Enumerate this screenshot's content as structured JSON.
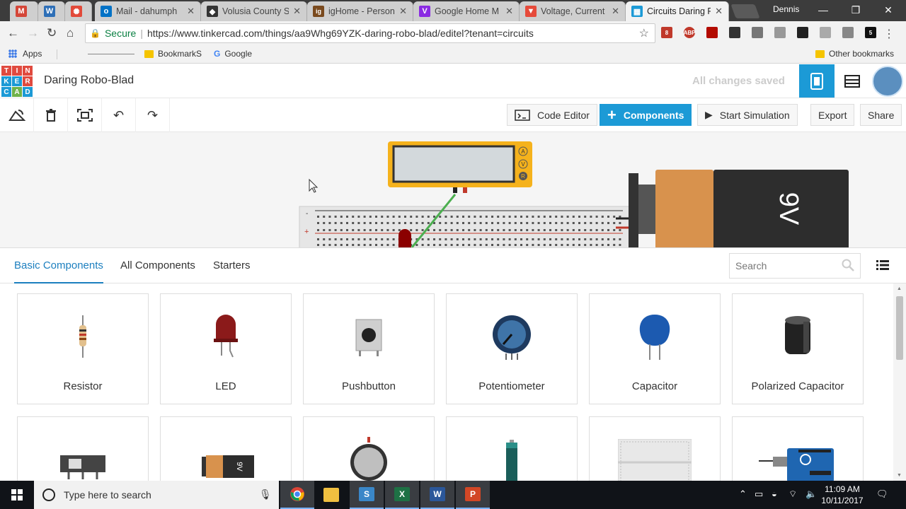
{
  "browser": {
    "tabs": [
      {
        "title": "",
        "icon": "gmail-icon",
        "color": "#d44638",
        "glyph": "M"
      },
      {
        "title": "",
        "icon": "wordpress-icon",
        "color": "#2e6fb7",
        "glyph": "W"
      },
      {
        "title": "",
        "icon": "aperture-icon",
        "color": "#e24a3a",
        "glyph": "✺"
      },
      {
        "title": "Mail - dahumph",
        "icon": "outlook-icon",
        "color": "#0072c6",
        "glyph": "o"
      },
      {
        "title": "Volusia County S",
        "icon": "volusia-icon",
        "color": "#333333",
        "glyph": "◆"
      },
      {
        "title": "igHome - Person",
        "icon": "ighome-icon",
        "color": "#7a4a1e",
        "glyph": "ig"
      },
      {
        "title": "Google Home M",
        "icon": "vivaldi-icon",
        "color": "#8a2be2",
        "glyph": "V"
      },
      {
        "title": "Voltage, Current",
        "icon": "bookmark-red-icon",
        "color": "#e64a3a",
        "glyph": "▼"
      },
      {
        "title": "Circuits Daring R",
        "icon": "tinkercad-icon",
        "color": "#1c9ad6",
        "glyph": "▦"
      }
    ],
    "user": "Dennis",
    "url_secure": "Secure",
    "url": "https://www.tinkercad.com/things/aa9Whg69YZK-daring-robo-blad/editel?tenant=circuits",
    "bookmarks": {
      "apps": "Apps",
      "folder1": "BookmarkS",
      "google": "Google",
      "other": "Other bookmarks"
    },
    "extensions": [
      {
        "icon": "calendar-icon",
        "color": "#c0392b",
        "badge": "8"
      },
      {
        "icon": "adblock-icon",
        "color": "#c0392b",
        "badge": "ABP"
      },
      {
        "icon": "pdf-icon",
        "color": "#b30b00",
        "badge": ""
      },
      {
        "icon": "film-icon",
        "color": "#333333",
        "badge": ""
      },
      {
        "icon": "shield-icon",
        "color": "#777777",
        "badge": ""
      },
      {
        "icon": "leaf-icon",
        "color": "#999999",
        "badge": ""
      },
      {
        "icon": "cloud-icon",
        "color": "#222222",
        "badge": ""
      },
      {
        "icon": "printer-icon",
        "color": "#aaaaaa",
        "badge": ""
      },
      {
        "icon": "translate-icon",
        "color": "#888888",
        "badge": ""
      },
      {
        "icon": "amazon-icon",
        "color": "#111111",
        "badge": "5"
      }
    ]
  },
  "app": {
    "logo_letters": [
      "T",
      "I",
      "N",
      "K",
      "E",
      "R",
      "C",
      "A",
      "D"
    ],
    "logo_colors": [
      "#e04a3f",
      "#e04a3f",
      "#e04a3f",
      "#1c9ad6",
      "#1c9ad6",
      "#e04a3f",
      "#1c9ad6",
      "#6fb24a",
      "#1c9ad6"
    ],
    "project_title": "Daring Robo-Blad",
    "save_status": "All changes saved",
    "accent": "#1c9ad6"
  },
  "editor_toolbar": {
    "code_editor": "Code Editor",
    "components": "Components",
    "start_simulation": "Start Simulation",
    "export": "Export",
    "share": "Share"
  },
  "canvas": {
    "multimeter_modes": [
      "A",
      "V",
      "R"
    ],
    "battery_label": "9V"
  },
  "panel": {
    "tabs": [
      "Basic Components",
      "All Components",
      "Starters"
    ],
    "search_placeholder": "Search",
    "components": [
      "Resistor",
      "LED",
      "Pushbutton",
      "Potentiometer",
      "Capacitor",
      "Polarized Capacitor",
      "",
      "",
      "",
      "",
      "",
      ""
    ]
  },
  "taskbar": {
    "search_placeholder": "Type here to search",
    "time": "11:09 AM",
    "date": "10/11/2017"
  }
}
